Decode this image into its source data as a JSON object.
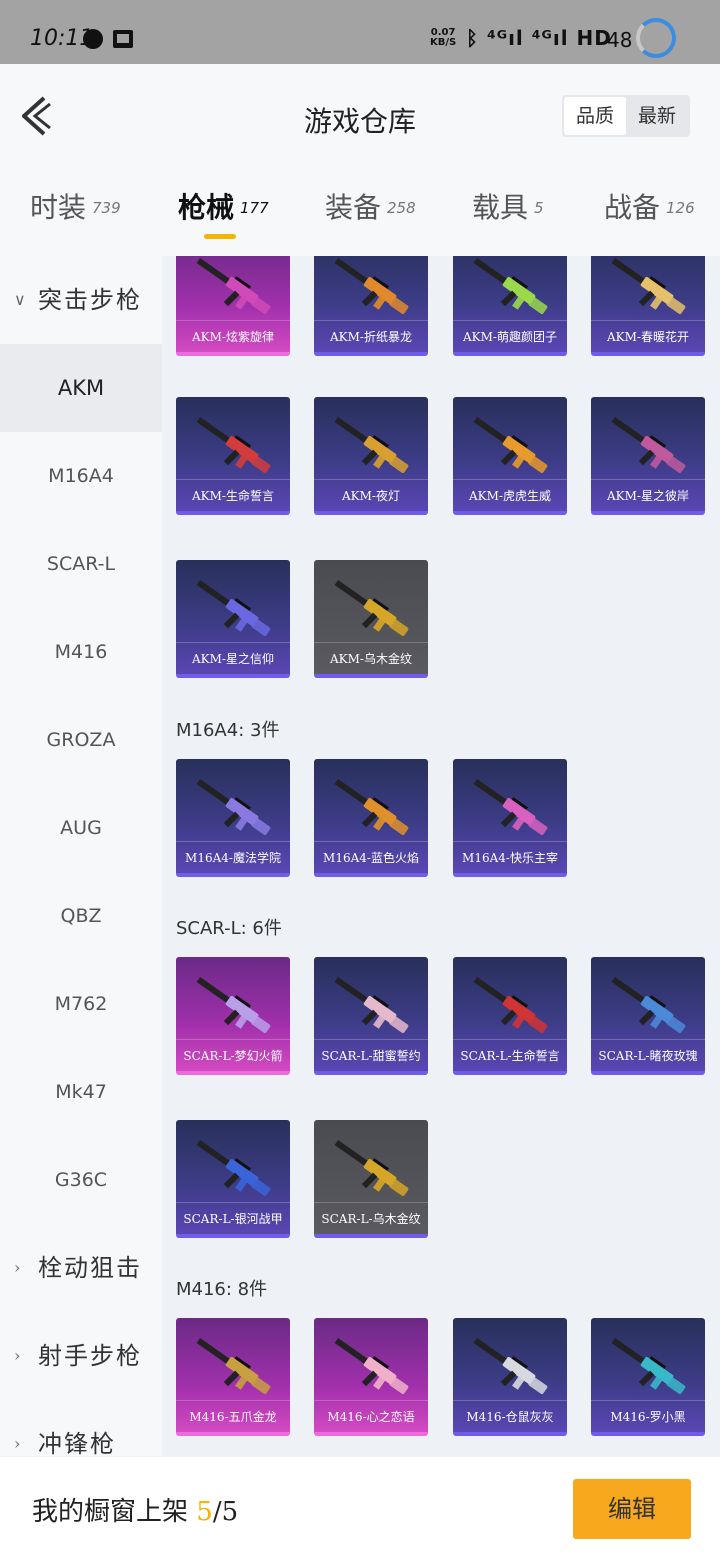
{
  "status_bar": {
    "time": "10:11",
    "net_speed_value": "0.07",
    "net_speed_unit": "KB/S",
    "signal_text": "ᛒ ⁴ᴳıl ⁴ᴳıl HD",
    "battery": "48"
  },
  "header": {
    "title": "游戏仓库",
    "sort_options": [
      "品质",
      "最新"
    ],
    "active_sort": "品质"
  },
  "category_tabs": [
    {
      "label": "时装",
      "count": "739"
    },
    {
      "label": "枪械",
      "count": "177"
    },
    {
      "label": "装备",
      "count": "258"
    },
    {
      "label": "载具",
      "count": "5"
    },
    {
      "label": "战备",
      "count": "126"
    }
  ],
  "active_tab": "枪械",
  "sidebar": {
    "groups": [
      {
        "label": "突击步枪",
        "expanded": true
      },
      {
        "label": "栓动狙击",
        "expanded": false
      },
      {
        "label": "射手步枪",
        "expanded": false
      },
      {
        "label": "冲锋枪",
        "expanded": false
      }
    ],
    "items": [
      "AKM",
      "M16A4",
      "SCAR-L",
      "M416",
      "GROZA",
      "AUG",
      "QBZ",
      "M762",
      "Mk47",
      "G36C"
    ],
    "active_item": "AKM"
  },
  "sections": [
    {
      "heading": "",
      "items": [
        {
          "name": "AKM-炫紫旋律",
          "style": "pink",
          "accent": "#d04ab8"
        },
        {
          "name": "AKM-折纸暴龙",
          "style": "purple",
          "accent": "#e08a2c"
        },
        {
          "name": "AKM-萌趣颜团子",
          "style": "purple",
          "accent": "#9ad94a"
        },
        {
          "name": "AKM-春暖花开",
          "style": "purple",
          "accent": "#e6c06a"
        },
        {
          "name": "AKM-生命誓言",
          "style": "purple",
          "accent": "#d23c3c"
        },
        {
          "name": "AKM-夜灯",
          "style": "purple",
          "accent": "#d8a030"
        },
        {
          "name": "AKM-虎虎生威",
          "style": "purple",
          "accent": "#e89a2a"
        },
        {
          "name": "AKM-星之彼岸",
          "style": "purple",
          "accent": "#c05a9c"
        },
        {
          "name": "AKM-星之信仰",
          "style": "purple",
          "accent": "#6a68e0"
        },
        {
          "name": "AKM-乌木金纹",
          "style": "gray",
          "accent": "#d6a628"
        }
      ]
    },
    {
      "heading": "M16A4: 3件",
      "items": [
        {
          "name": "M16A4-魔法学院",
          "style": "purple",
          "accent": "#8a7ae0"
        },
        {
          "name": "M16A4-蓝色火焰",
          "style": "purple",
          "accent": "#e0902a"
        },
        {
          "name": "M16A4-快乐主宰",
          "style": "purple",
          "accent": "#d860c0"
        }
      ]
    },
    {
      "heading": "SCAR-L: 6件",
      "items": [
        {
          "name": "SCAR-L-梦幻火箭",
          "style": "pink",
          "accent": "#b8a0e8"
        },
        {
          "name": "SCAR-L-甜蜜誓约",
          "style": "purple",
          "accent": "#e6b8cc"
        },
        {
          "name": "SCAR-L-生命誓言",
          "style": "purple",
          "accent": "#d03434"
        },
        {
          "name": "SCAR-L-睹夜玫瑰",
          "style": "purple",
          "accent": "#4a8ad8"
        },
        {
          "name": "SCAR-L-银河战甲",
          "style": "purple",
          "accent": "#3a64d8"
        },
        {
          "name": "SCAR-L-乌木金纹",
          "style": "gray",
          "accent": "#d6a628"
        }
      ]
    },
    {
      "heading": "M416: 8件",
      "items": [
        {
          "name": "M416-五爪金龙",
          "style": "pink",
          "accent": "#c8a040"
        },
        {
          "name": "M416-心之恋语",
          "style": "pink",
          "accent": "#f0b0c8"
        },
        {
          "name": "M416-仓鼠灰灰",
          "style": "purple",
          "accent": "#d8d8e0"
        },
        {
          "name": "M416-罗小黑",
          "style": "purple",
          "accent": "#38b8c8"
        }
      ]
    }
  ],
  "footer": {
    "label": "我的橱窗上架",
    "current": "5",
    "total": "/5",
    "edit_label": "编辑"
  }
}
